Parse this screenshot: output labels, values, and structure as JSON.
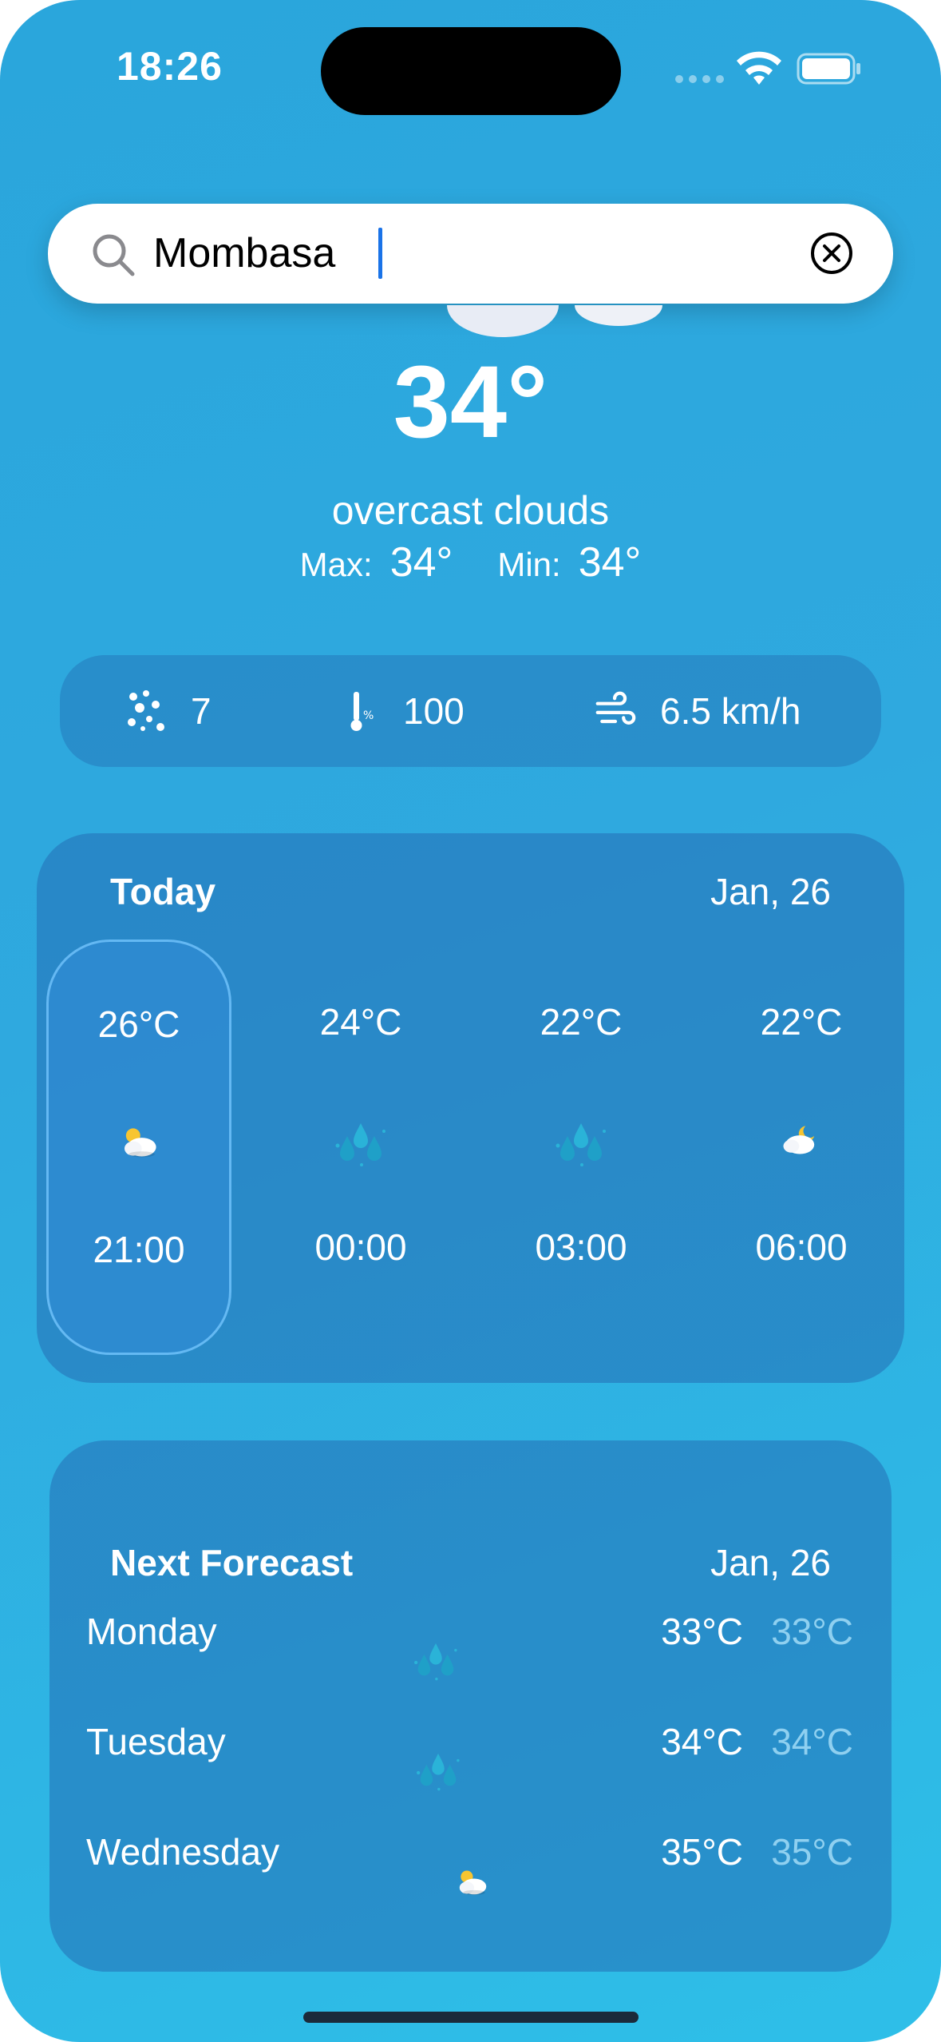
{
  "status_bar": {
    "time": "18:26"
  },
  "search": {
    "value": "Mombasa",
    "placeholder": ""
  },
  "current": {
    "temperature": "34°",
    "condition": "overcast clouds",
    "max_label": "Max:",
    "max_value": "34°",
    "min_label": "Min:",
    "min_value": "34°"
  },
  "stats": {
    "precipitation": "7",
    "humidity": "100",
    "wind": "6.5 km/h"
  },
  "today": {
    "title": "Today",
    "date": "Jan, 26",
    "hours": [
      {
        "temp": "26°C",
        "time": "21:00",
        "icon": "cloud-sun-icon"
      },
      {
        "temp": "24°C",
        "time": "00:00",
        "icon": "rain-drops-icon"
      },
      {
        "temp": "22°C",
        "time": "03:00",
        "icon": "rain-drops-icon"
      },
      {
        "temp": "22°C",
        "time": "06:00",
        "icon": "cloud-moon-icon"
      }
    ]
  },
  "next_forecast": {
    "title": "Next Forecast",
    "date": "Jan, 26",
    "days": [
      {
        "day": "Monday",
        "high": "33°C",
        "low": "33°C",
        "icon": "rain-drops-icon"
      },
      {
        "day": "Tuesday",
        "high": "34°C",
        "low": "34°C",
        "icon": "rain-drops-icon"
      },
      {
        "day": "Wednesday",
        "high": "35°C",
        "low": "35°C",
        "icon": "cloud-sun-icon"
      }
    ]
  },
  "colors": {
    "background_top": "#2aa6dc",
    "background_bottom": "#2ebfe8",
    "card": "#2a7fbf",
    "low_temp": "#8fd0f0",
    "caret": "#1a73e8"
  }
}
